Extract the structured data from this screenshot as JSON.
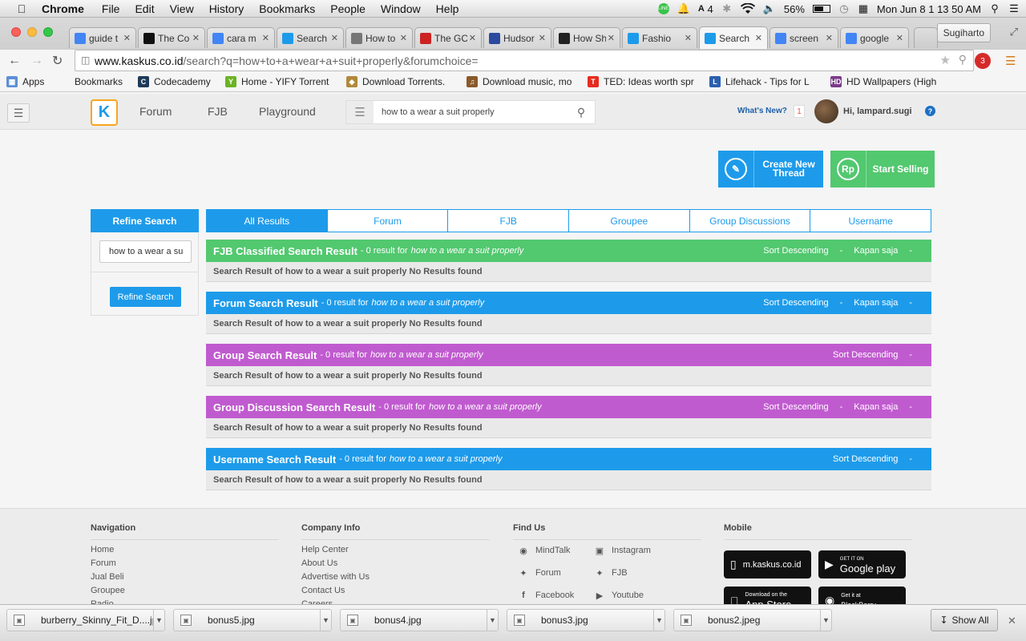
{
  "macos_menubar": {
    "app": "Chrome",
    "menus": [
      "File",
      "Edit",
      "View",
      "History",
      "Bookmarks",
      "People",
      "Window",
      "Help"
    ],
    "status": {
      "adobe_count": "4",
      "battery": "56%",
      "clock": "Mon Jun 8  1 13 50 AM"
    }
  },
  "browser": {
    "tabs": [
      {
        "title": "guide t",
        "icon": "google-icon",
        "color": "#4285f4"
      },
      {
        "title": "The Co",
        "icon": "d-icon",
        "color": "#111111"
      },
      {
        "title": "cara m",
        "icon": "google-icon",
        "color": "#4285f4"
      },
      {
        "title": "Search",
        "icon": "kaskus-icon",
        "color": "#1d9bea"
      },
      {
        "title": "How to",
        "icon": "apple-icon",
        "color": "#777777"
      },
      {
        "title": "The GC",
        "icon": "gq-icon",
        "color": "#cc2222"
      },
      {
        "title": "Hudsor",
        "icon": "grid-icon",
        "color": "#2b4aa0"
      },
      {
        "title": "How Sh",
        "icon": "mustache-icon",
        "color": "#222222"
      },
      {
        "title": "Fashio",
        "icon": "kaskus-icon",
        "color": "#1d9bea"
      },
      {
        "title": "Search",
        "icon": "kaskus-icon",
        "color": "#1d9bea"
      },
      {
        "title": "screen",
        "icon": "google-icon",
        "color": "#4285f4"
      },
      {
        "title": "google",
        "icon": "google-icon",
        "color": "#4285f4"
      }
    ],
    "active_tab_index": 9,
    "profile_name": "Sugiharto",
    "url_host": "www.kaskus.co.id",
    "url_path": "/search?q=how+to+a+wear+a+suit+properly&forumchoice=",
    "extension_badge": "3",
    "bookmarks": [
      {
        "label": "Apps",
        "icon": "apps-grid-icon"
      },
      {
        "label": "Bookmarks",
        "icon": "folder-icon"
      },
      {
        "label": "Codecademy",
        "icon": "codecademy-icon"
      },
      {
        "label": "Home - YIFY Torrent",
        "icon": "yify-icon"
      },
      {
        "label": "Download Torrents.",
        "icon": "shield-icon"
      },
      {
        "label": "Download music, mo",
        "icon": "music-icon"
      },
      {
        "label": "TED: Ideas worth spr",
        "icon": "ted-icon"
      },
      {
        "label": "Lifehack - Tips for L",
        "icon": "lifehack-icon"
      },
      {
        "label": "HD Wallpapers (High",
        "icon": "hd-icon"
      }
    ]
  },
  "site": {
    "nav": [
      "Forum",
      "FJB",
      "Playground"
    ],
    "search_value": "how to a wear a suit properly",
    "whats_new": "What's New?",
    "notification_count": "1",
    "greeting": "Hi, lampard.sugi",
    "create_thread": "Create New Thread",
    "start_selling": "Start Selling",
    "rp_symbol": "Rp",
    "refine_title": "Refine Search",
    "refine_value": "how to a wear a su",
    "refine_button": "Refine Search",
    "result_tabs": [
      "All Results",
      "Forum",
      "FJB",
      "Groupee",
      "Group Discussions",
      "Username"
    ],
    "sections": [
      {
        "title": "FJB Classified Search Result",
        "count_text": "- 0 result for",
        "query": "how to a wear a suit properly",
        "sort": "Sort Descending",
        "time": "Kapan saja",
        "color": "#52c86f",
        "empty": "Search Result of how to a wear a suit properly No Results found"
      },
      {
        "title": "Forum Search Result",
        "count_text": "- 0 result for",
        "query": "how to a wear a suit properly",
        "sort": "Sort Descending",
        "time": "Kapan saja",
        "color": "#1d9bea",
        "empty": "Search Result of how to a wear a suit properly No Results found"
      },
      {
        "title": "Group Search Result",
        "count_text": "- 0 result for",
        "query": "how to a wear a suit properly",
        "sort": "Sort Descending",
        "time": "",
        "color": "#c05bcf",
        "empty": "Search Result of how to a wear a suit properly No Results found"
      },
      {
        "title": "Group Discussion Search Result",
        "count_text": "- 0 result for",
        "query": "how to a wear a suit properly",
        "sort": "Sort Descending",
        "time": "Kapan saja",
        "color": "#c05bcf",
        "empty": "Search Result of how to a wear a suit properly No Results found"
      },
      {
        "title": "Username Search Result",
        "count_text": "- 0 result for",
        "query": "how to a wear a suit properly",
        "sort": "Sort Descending",
        "time": "",
        "color": "#1d9bea",
        "empty": "Search Result of how to a wear a suit properly No Results found"
      }
    ],
    "dash": "-"
  },
  "footer": {
    "navigation": {
      "title": "Navigation",
      "links": [
        "Home",
        "Forum",
        "Jual Beli",
        "Groupee",
        "Radio"
      ]
    },
    "company": {
      "title": "Company Info",
      "links": [
        "Help Center",
        "About Us",
        "Advertise with Us",
        "Contact Us",
        "Careers"
      ]
    },
    "find_us": {
      "title": "Find Us",
      "links": [
        {
          "label": "MindTalk",
          "icon": "mindtalk-icon"
        },
        {
          "label": "Instagram",
          "icon": "instagram-icon"
        },
        {
          "label": "Forum",
          "icon": "twitter-icon"
        },
        {
          "label": "FJB",
          "icon": "twitter-icon"
        },
        {
          "label": "Facebook",
          "icon": "facebook-icon"
        },
        {
          "label": "Youtube",
          "icon": "youtube-icon"
        }
      ]
    },
    "mobile": {
      "title": "Mobile",
      "badges": [
        {
          "label": "m.kaskus.co.id",
          "icon": "phone-icon"
        },
        {
          "label": "Google play",
          "icon": "google-play-icon",
          "sub": "GET IT ON"
        },
        {
          "label": "App Store",
          "icon": "apple-icon",
          "sub": "Download on the"
        },
        {
          "label": "BlackBerry",
          "icon": "blackberry-icon",
          "sub": "Get it at"
        }
      ]
    }
  },
  "downloads": {
    "items": [
      "burberry_Skinny_Fit_D....jpg",
      "bonus5.jpg",
      "bonus4.jpg",
      "bonus3.jpg",
      "bonus2.jpeg"
    ],
    "show_all": "Show All"
  }
}
